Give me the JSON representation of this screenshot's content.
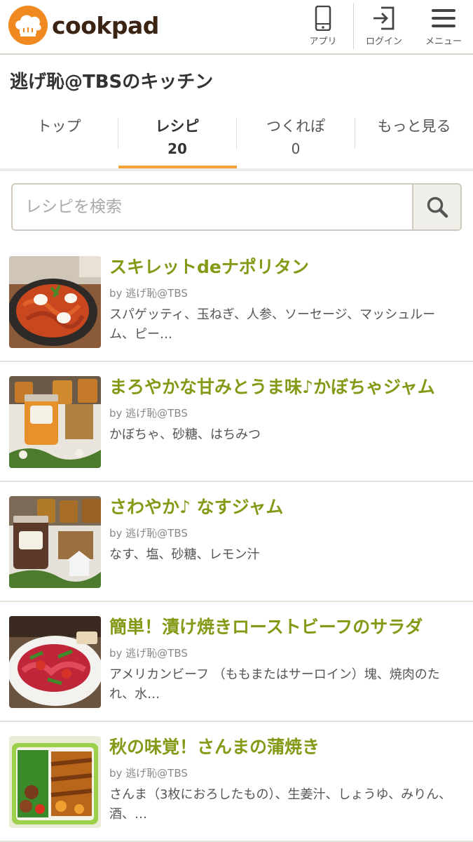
{
  "header": {
    "logo_text": "cookpad",
    "buttons": [
      {
        "label": "アプリ",
        "icon": "smartphone-icon"
      },
      {
        "label": "ログイン",
        "icon": "login-icon"
      },
      {
        "label": "メニュー",
        "icon": "hamburger-menu-icon"
      }
    ]
  },
  "kitchen": {
    "title": "逃げ恥@TBSのキッチン"
  },
  "tabs": [
    {
      "label": "トップ",
      "count": ""
    },
    {
      "label": "レシピ",
      "count": "20",
      "active": true
    },
    {
      "label": "つくれぽ",
      "count": "0"
    },
    {
      "label": "もっと見る",
      "count": ""
    }
  ],
  "search": {
    "placeholder": "レシピを検索",
    "value": ""
  },
  "recipes": [
    {
      "title": "スキレットdeナポリタン",
      "author": "by 逃げ恥@TBS",
      "ingredients": "スパゲッティ、玉ねぎ、人参、ソーセージ、マッシュルーム、ピー…"
    },
    {
      "title": "まろやかな甘みとうま味♪かぼちゃジャム",
      "author": "by 逃げ恥@TBS",
      "ingredients": "かぼちゃ、砂糖、はちみつ"
    },
    {
      "title": "さわやか♪ なすジャム",
      "author": "by 逃げ恥@TBS",
      "ingredients": "なす、塩、砂糖、レモン汁"
    },
    {
      "title": "簡単！漬け焼きローストビーフのサラダ",
      "author": "by 逃げ恥@TBS",
      "ingredients": "アメリカンビーフ （ももまたはサーロイン）塊、焼肉のたれ、水…"
    },
    {
      "title": "秋の味覚！さんまの蒲焼き",
      "author": "by 逃げ恥@TBS",
      "ingredients": "さんま（3枚におろしたもの）、生姜汁、しょうゆ、みりん、酒、…"
    }
  ],
  "colors": {
    "brand_orange": "#f0891f",
    "recipe_title_green": "#849a17",
    "tab_active_underline": "#f6a236"
  }
}
